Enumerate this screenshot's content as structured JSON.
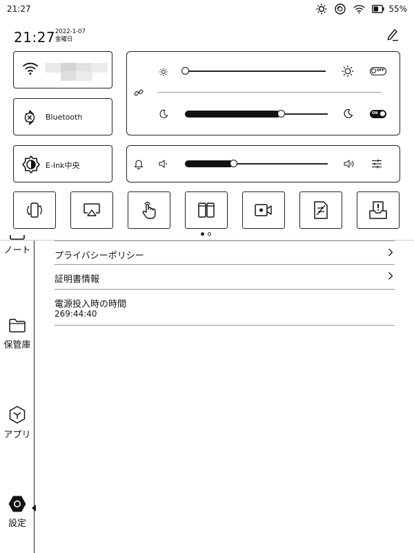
{
  "status_bar": {
    "time": "21:27",
    "battery": "55%",
    "icons": [
      "brightness-icon",
      "sync-icon",
      "wifi-icon",
      "battery-icon"
    ]
  },
  "panel": {
    "clock": "21:27",
    "date": "2022-1-07",
    "weekday": "金曜日",
    "bluetooth_label": "Bluetooth",
    "eink_label": "E-Ink中央",
    "brightness": {
      "front_light_level": 0.0,
      "front_light_toggle": "OFF",
      "warm_light_level": 0.67,
      "warm_light_toggle": "ON"
    },
    "volume_level": 0.34,
    "shortcuts": [
      "rotate-screen-icon",
      "cast-screen-icon",
      "touch-icon",
      "split-screen-icon",
      "screen-record-icon",
      "no-refresh-icon",
      "screenshot-tray-icon"
    ],
    "page_index": 1,
    "page_count": 2
  },
  "sidebar": {
    "items": [
      {
        "label": "ノート",
        "icon": "notebook-icon"
      },
      {
        "label": "保管庫",
        "icon": "folder-icon"
      },
      {
        "label": "アプリ",
        "icon": "apps-icon"
      },
      {
        "label": "設定",
        "icon": "settings-icon"
      }
    ]
  },
  "content": {
    "rows": [
      {
        "label": "プライバシーポリシー"
      },
      {
        "label": "証明書情報"
      },
      {
        "label": "電源投入時の時間",
        "value": "269:44:40"
      }
    ]
  }
}
